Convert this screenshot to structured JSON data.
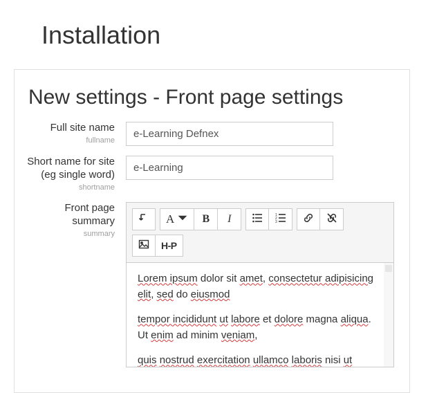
{
  "page_title": "Installation",
  "section_title": "New settings - Front page settings",
  "fields": {
    "fullname": {
      "label": "Full site name",
      "tech": "fullname",
      "value": "e-Learning Defnex"
    },
    "shortname": {
      "label": "Short name for site (eg single word)",
      "tech": "shortname",
      "value": "e-Learning"
    },
    "summary": {
      "label": "Front page summary",
      "tech": "summary"
    }
  },
  "editor_content": {
    "p1a": "Lorem ipsum",
    "p1b": " dolor sit ",
    "p1c": "amet",
    "p1d": ", ",
    "p1e": "consectetur adipisicing elit",
    "p1f": ", ",
    "p1g": "sed",
    "p1h": " do ",
    "p1i": "eiusmod",
    "p2a": "tempor incididunt",
    "p2b": " ",
    "p2c": "ut",
    "p2d": " ",
    "p2e": "labore",
    "p2f": " et ",
    "p2g": "dolore",
    "p2h": " magna ",
    "p2i": "aliqua",
    "p2j": ". Ut ",
    "p2k": "enim",
    "p2l": " ad minim ",
    "p2m": "veniam",
    "p2n": ",",
    "p3a": "quis",
    "p3b": " ",
    "p3c": "nostrud",
    "p3d": " ",
    "p3e": "exercitation",
    "p3f": " ",
    "p3g": "ullamco",
    "p3h": " ",
    "p3i": "laboris",
    "p3j": " nisi ",
    "p3k": "ut"
  },
  "toolbar": {
    "para": "A",
    "bold": "B",
    "italic": "I",
    "h5p": "H-P"
  }
}
